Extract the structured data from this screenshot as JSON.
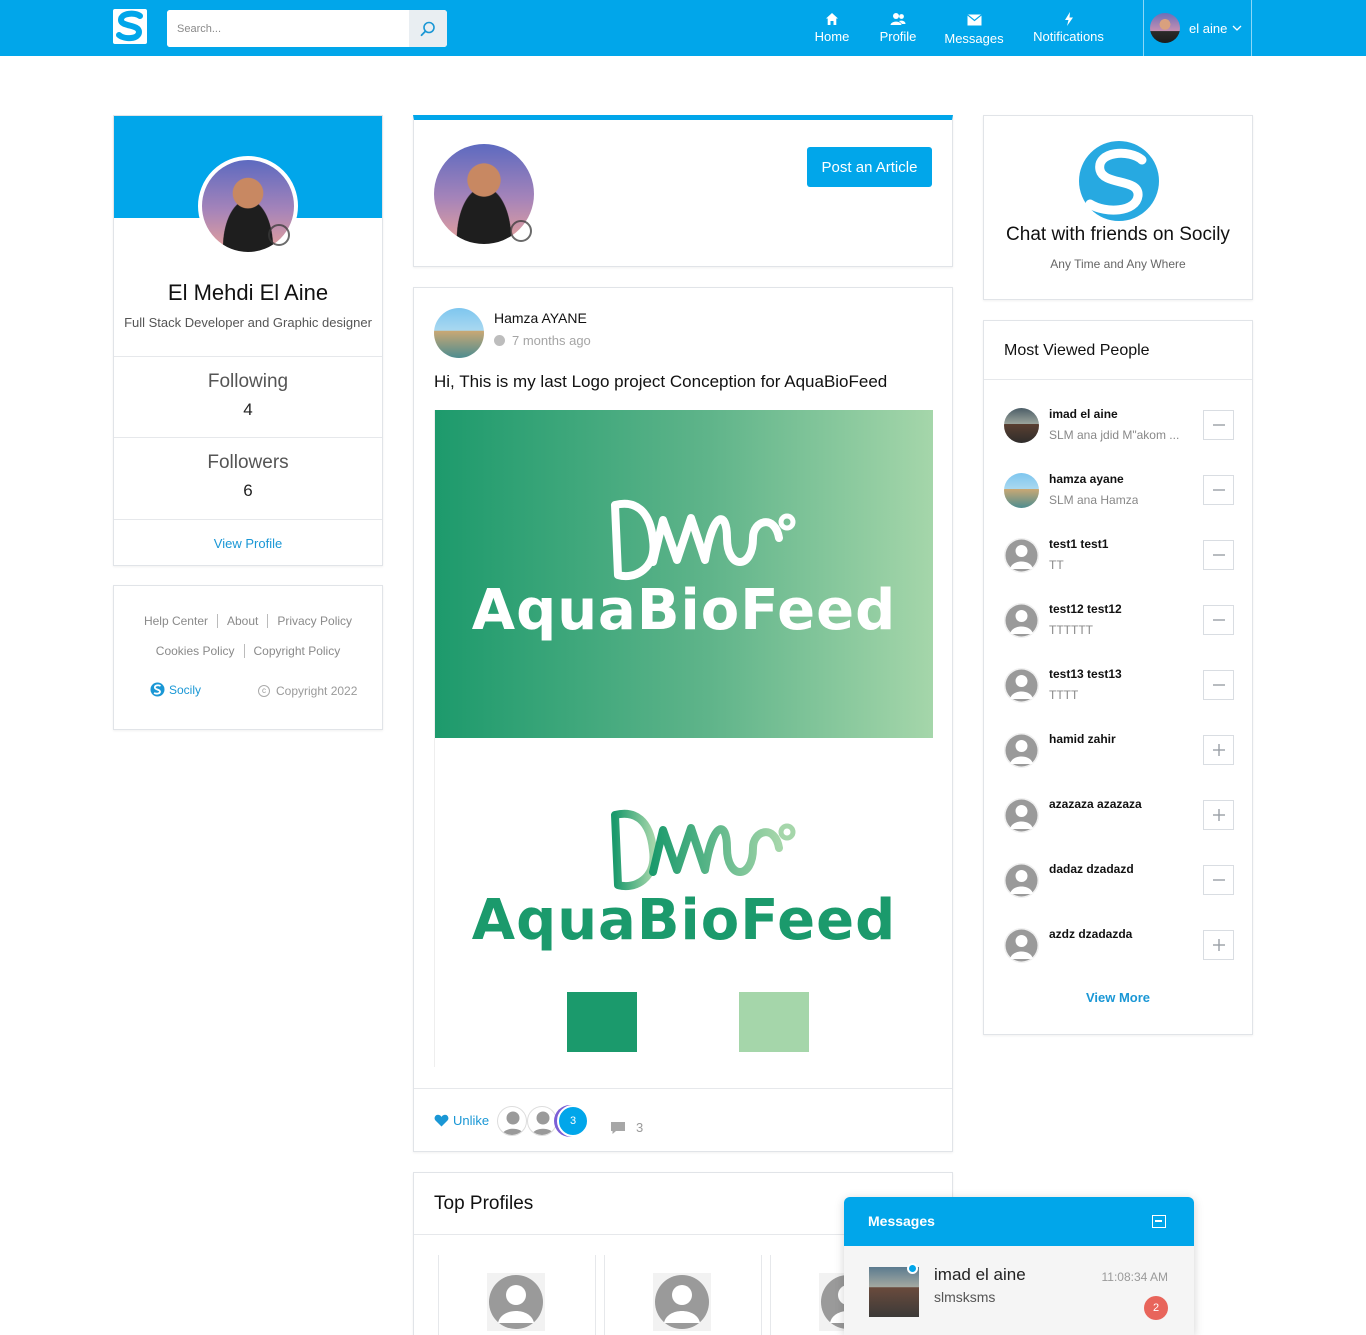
{
  "header": {
    "search_placeholder": "Search...",
    "nav": [
      {
        "label": "Home",
        "icon": "home-icon"
      },
      {
        "label": "Profile",
        "icon": "profile-icon"
      },
      {
        "label": "Messages",
        "icon": "envelope-icon"
      },
      {
        "label": "Notifications",
        "icon": "bolt-icon"
      }
    ],
    "user_name": "el aine"
  },
  "profile": {
    "name": "El Mehdi El Aine",
    "role": "Full Stack Developer and Graphic designer",
    "following_label": "Following",
    "following_count": "4",
    "followers_label": "Followers",
    "followers_count": "6",
    "view_profile": "View Profile"
  },
  "footer_links": {
    "row1": [
      "Help Center",
      "About",
      "Privacy Policy"
    ],
    "row2": [
      "Cookies Policy",
      "Copyright Policy"
    ],
    "brand": "Socily",
    "copyright": "Copyright 2022"
  },
  "composer": {
    "post_button": "Post an Article"
  },
  "post": {
    "author": "Hamza AYANE",
    "time": "7 months ago",
    "text": "Hi, This is my last Logo project Conception for AquaBioFeed",
    "logo_text": "AquaBioFeed",
    "colors": {
      "dark_green": "#1b9a6c",
      "light_green": "#a5d6aa"
    },
    "unlike_label": "Unlike",
    "likes_count": "3",
    "comments_count": "3"
  },
  "top_profiles": {
    "title": "Top Profiles"
  },
  "promo": {
    "title": "Chat with friends on Socily",
    "subtitle": "Any Time and Any Where"
  },
  "most_viewed": {
    "title": "Most Viewed People",
    "people": [
      {
        "name": "imad el aine",
        "message": "SLM ana jdid M\"akom ...",
        "action": "minus"
      },
      {
        "name": "hamza ayane",
        "message": "SLM ana Hamza",
        "action": "minus"
      },
      {
        "name": "test1 test1",
        "message": "TT",
        "action": "minus"
      },
      {
        "name": "test12 test12",
        "message": "TTTTTT",
        "action": "minus"
      },
      {
        "name": "test13 test13",
        "message": "TTTT",
        "action": "minus"
      },
      {
        "name": "hamid zahir",
        "message": "",
        "action": "plus"
      },
      {
        "name": "azazaza azazaza",
        "message": "",
        "action": "plus"
      },
      {
        "name": "dadaz dzadazd",
        "message": "",
        "action": "minus"
      },
      {
        "name": "azdz dzadazda",
        "message": "",
        "action": "plus"
      }
    ],
    "view_more": "View More"
  },
  "messages_panel": {
    "title": "Messages",
    "conversation": {
      "name": "imad el aine",
      "preview": "slmsksms",
      "time": "11:08:34 AM",
      "unread": "2"
    }
  },
  "theme": {
    "accent": "#01a6ea",
    "link": "#1a97d5"
  }
}
